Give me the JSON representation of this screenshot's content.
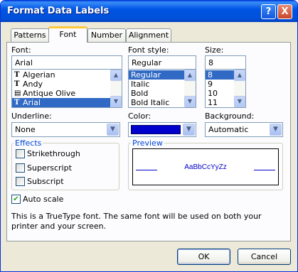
{
  "window": {
    "title": "Format Data Labels",
    "help_label": "?",
    "close_label": "X"
  },
  "tabs": [
    {
      "label": "Patterns"
    },
    {
      "label": "Font"
    },
    {
      "label": "Number"
    },
    {
      "label": "Alignment"
    }
  ],
  "font": {
    "label": "Font:",
    "value": "Arial",
    "items": [
      "Algerian",
      "Andy",
      "Antique Olive",
      "Arial"
    ],
    "selected_index": 3
  },
  "style": {
    "label": "Font style:",
    "value": "Regular",
    "items": [
      "Regular",
      "Italic",
      "Bold",
      "Bold Italic"
    ],
    "selected_index": 0
  },
  "size": {
    "label": "Size:",
    "value": "8",
    "items": [
      "8",
      "9",
      "10",
      "11"
    ],
    "selected_index": 0
  },
  "underline": {
    "label": "Underline:",
    "value": "None"
  },
  "color": {
    "label": "Color:",
    "value_color": "#0000cc"
  },
  "background": {
    "label": "Background:",
    "value": "Automatic"
  },
  "effects": {
    "title": "Effects",
    "strikethrough": "Strikethrough",
    "superscript": "Superscript",
    "subscript": "Subscript"
  },
  "preview": {
    "title": "Preview",
    "sample": "AaBbCcYyZz",
    "sample_color": "#0000cc"
  },
  "auto_scale": {
    "label": "Auto scale",
    "checked": true
  },
  "info": "This is a TrueType font.  The same font will be used on both your printer and your screen.",
  "buttons": {
    "ok": "OK",
    "cancel": "Cancel"
  }
}
